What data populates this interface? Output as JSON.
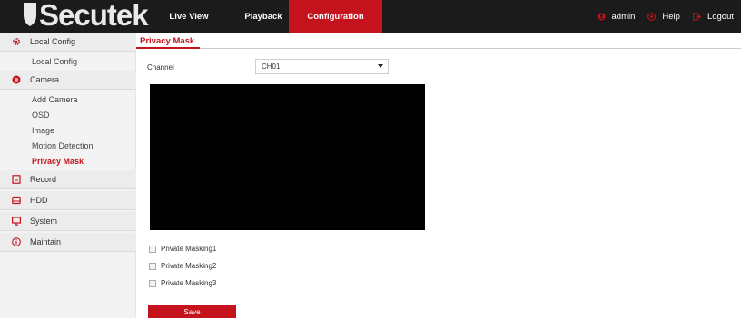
{
  "header": {
    "logo_text": "Secutek",
    "nav": [
      "Live View",
      "Playback",
      "Configuration"
    ],
    "active_nav": "Configuration",
    "user": "admin",
    "help": "Help",
    "logout": "Logout"
  },
  "sidebar": {
    "local_config": "Local Config",
    "local_config_children": [
      "Local Config"
    ],
    "camera": "Camera",
    "camera_children": [
      "Add Camera",
      "OSD",
      "Image",
      "Motion Detection",
      "Privacy Mask"
    ],
    "active_child": "Privacy Mask",
    "record": "Record",
    "hdd": "HDD",
    "system": "System",
    "maintain": "Maintain"
  },
  "content": {
    "tab": "Privacy Mask",
    "channel_label": "Channel",
    "channel_value": "CH01",
    "masks": [
      "Private Masking1",
      "Private Masking2",
      "Private Masking3"
    ],
    "save_label": "Save"
  },
  "colors": {
    "accent": "#c4131d",
    "topbar": "#1b1b1b"
  }
}
